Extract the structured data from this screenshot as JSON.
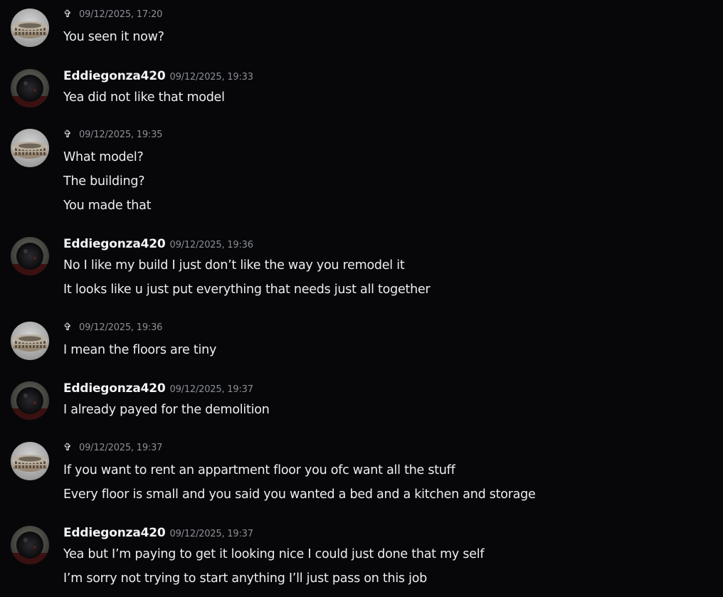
{
  "users": {
    "cross": {
      "name": "✞",
      "avatar_icon": "colosseum-avatar-icon"
    },
    "eddie": {
      "name": "Eddiegonza420",
      "avatar_icon": "dark-sphere-avatar-icon"
    }
  },
  "messages": [
    {
      "author": "✞",
      "timestamp": "09/12/2025, 17:20",
      "lines": [
        "You seen it now?"
      ]
    },
    {
      "author": "Eddiegonza420",
      "timestamp": "09/12/2025, 19:33",
      "lines": [
        "Yea did not like that model"
      ]
    },
    {
      "author": "✞",
      "timestamp": "09/12/2025, 19:35",
      "lines": [
        "What model?",
        "The building?",
        "You made that"
      ]
    },
    {
      "author": "Eddiegonza420",
      "timestamp": "09/12/2025, 19:36",
      "lines": [
        "No I like my build I just don’t like the way you remodel it",
        "It looks like u just put everything that needs just all together"
      ]
    },
    {
      "author": "✞",
      "timestamp": "09/12/2025, 19:36",
      "lines": [
        "I mean the floors are tiny"
      ]
    },
    {
      "author": "Eddiegonza420",
      "timestamp": "09/12/2025, 19:37",
      "lines": [
        "I already payed for the demolition"
      ]
    },
    {
      "author": "✞",
      "timestamp": "09/12/2025, 19:37",
      "lines": [
        "If you want to rent an appartment floor you ofc want all the stuff",
        "Every floor is small and you said you wanted a bed and a kitchen and storage"
      ]
    },
    {
      "author": "Eddiegonza420",
      "timestamp": "09/12/2025, 19:37",
      "lines": [
        "Yea but I’m paying to get it looking nice I could just done that my self",
        "I’m sorry not trying to start anything I’ll just pass on this job"
      ]
    }
  ]
}
